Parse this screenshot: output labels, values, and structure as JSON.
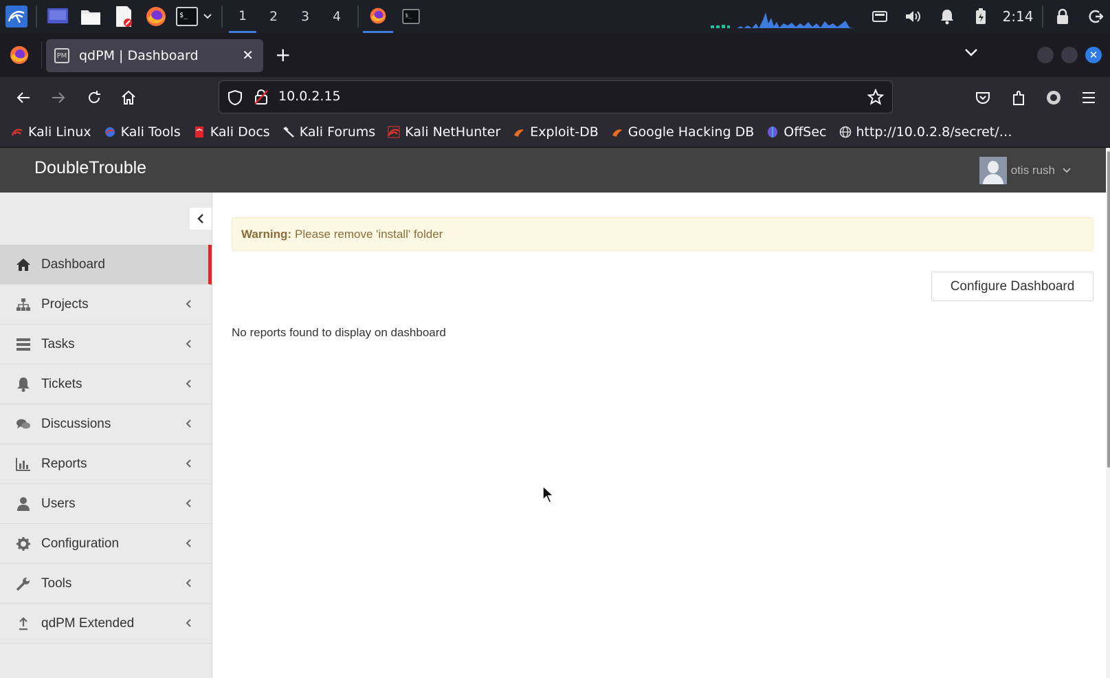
{
  "taskbar": {
    "workspaces": [
      "1",
      "2",
      "3",
      "4"
    ],
    "active_workspace": "1",
    "clock": "2:14",
    "icons": [
      "kali-menu-icon",
      "desktop-icon",
      "file-manager-icon",
      "text-editor-icon",
      "firefox-icon",
      "terminal-icon",
      "battery-icon",
      "volume-icon",
      "bell-icon",
      "power-icon",
      "lock-icon",
      "logout-icon"
    ]
  },
  "browser": {
    "tab_title": "qdPM | Dashboard",
    "tab_favicon": "PM",
    "url": "10.0.2.15",
    "bookmarks": [
      {
        "label": "Kali Linux",
        "icon": "kali-dragon-icon",
        "color": "#e0352b"
      },
      {
        "label": "Kali Tools",
        "icon": "kali-tools-icon",
        "color": "#3d6fe0"
      },
      {
        "label": "Kali Docs",
        "icon": "kali-docs-icon",
        "color": "#e0252d"
      },
      {
        "label": "Kali Forums",
        "icon": "kali-forums-icon",
        "color": "#dddddd"
      },
      {
        "label": "Kali NetHunter",
        "icon": "nethunter-icon",
        "color": "#e0352b"
      },
      {
        "label": "Exploit-DB",
        "icon": "exploit-db-icon",
        "color": "#e86b1f"
      },
      {
        "label": "Google Hacking DB",
        "icon": "ghdb-icon",
        "color": "#e86b1f"
      },
      {
        "label": "OffSec",
        "icon": "offsec-icon",
        "color": "#6a58d8"
      },
      {
        "label": "http://10.0.2.8/secret/…",
        "icon": "globe-icon",
        "color": "#cccccc"
      }
    ]
  },
  "app": {
    "brand": "DoubleTrouble",
    "user_name": "otis rush",
    "warning_label": "Warning:",
    "warning_text": "Please remove 'install' folder",
    "configure_button": "Configure Dashboard",
    "empty_message": "No reports found to display on dashboard",
    "accent_color": "#e0252d",
    "menu": [
      {
        "label": "Dashboard",
        "icon": "home-icon",
        "active": true
      },
      {
        "label": "Projects",
        "icon": "sitemap-icon"
      },
      {
        "label": "Tasks",
        "icon": "tasks-icon"
      },
      {
        "label": "Tickets",
        "icon": "bell-icon"
      },
      {
        "label": "Discussions",
        "icon": "comments-icon"
      },
      {
        "label": "Reports",
        "icon": "bar-chart-icon"
      },
      {
        "label": "Users",
        "icon": "user-icon"
      },
      {
        "label": "Configuration",
        "icon": "gear-icon"
      },
      {
        "label": "Tools",
        "icon": "wrench-icon"
      },
      {
        "label": "qdPM Extended",
        "icon": "upload-icon"
      }
    ]
  }
}
